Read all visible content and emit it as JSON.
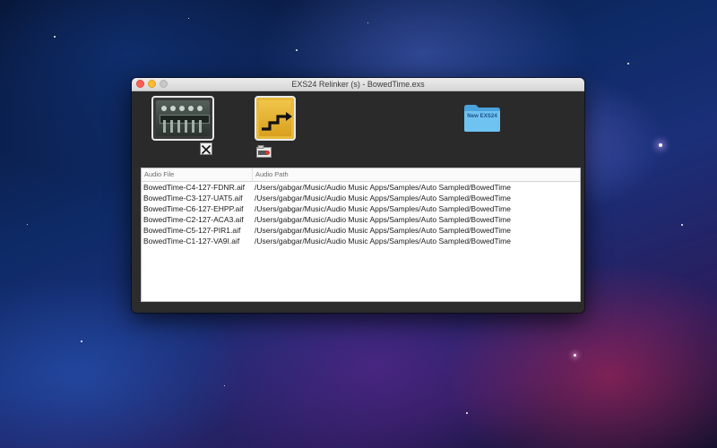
{
  "window": {
    "title": "EXS24 Relinker (s) - BowedTime.exs"
  },
  "toolbar": {
    "exs_button_icon": "exs24-sampler-icon",
    "relink_button_icon": "relink-stairs-icon",
    "remove_icon": "close-x-icon",
    "small_icon": "sampler-badge-icon",
    "new_folder_label": "New EXS24"
  },
  "table": {
    "columns": [
      "Audio File",
      "Audio Path"
    ],
    "rows": [
      {
        "file": "BowedTime-C4-127-FDNR.aif",
        "path": "/Users/gabgar/Music/Audio Music Apps/Samples/Auto Sampled/BowedTime"
      },
      {
        "file": "BowedTime-C3-127-UAT5.aif",
        "path": "/Users/gabgar/Music/Audio Music Apps/Samples/Auto Sampled/BowedTime"
      },
      {
        "file": "BowedTime-C6-127-EHPP.aif",
        "path": "/Users/gabgar/Music/Audio Music Apps/Samples/Auto Sampled/BowedTime"
      },
      {
        "file": "BowedTime-C2-127-ACA3.aif",
        "path": "/Users/gabgar/Music/Audio Music Apps/Samples/Auto Sampled/BowedTime"
      },
      {
        "file": "BowedTime-C5-127-PIR1.aif",
        "path": "/Users/gabgar/Music/Audio Music Apps/Samples/Auto Sampled/BowedTime"
      },
      {
        "file": "BowedTime-C1-127-VA9I.aif",
        "path": "/Users/gabgar/Music/Audio Music Apps/Samples/Auto Sampled/BowedTime"
      }
    ]
  },
  "colors": {
    "folder": "#5fb8ee",
    "relink_button": "#e8b93a",
    "window_bg": "#2c2c2c"
  }
}
